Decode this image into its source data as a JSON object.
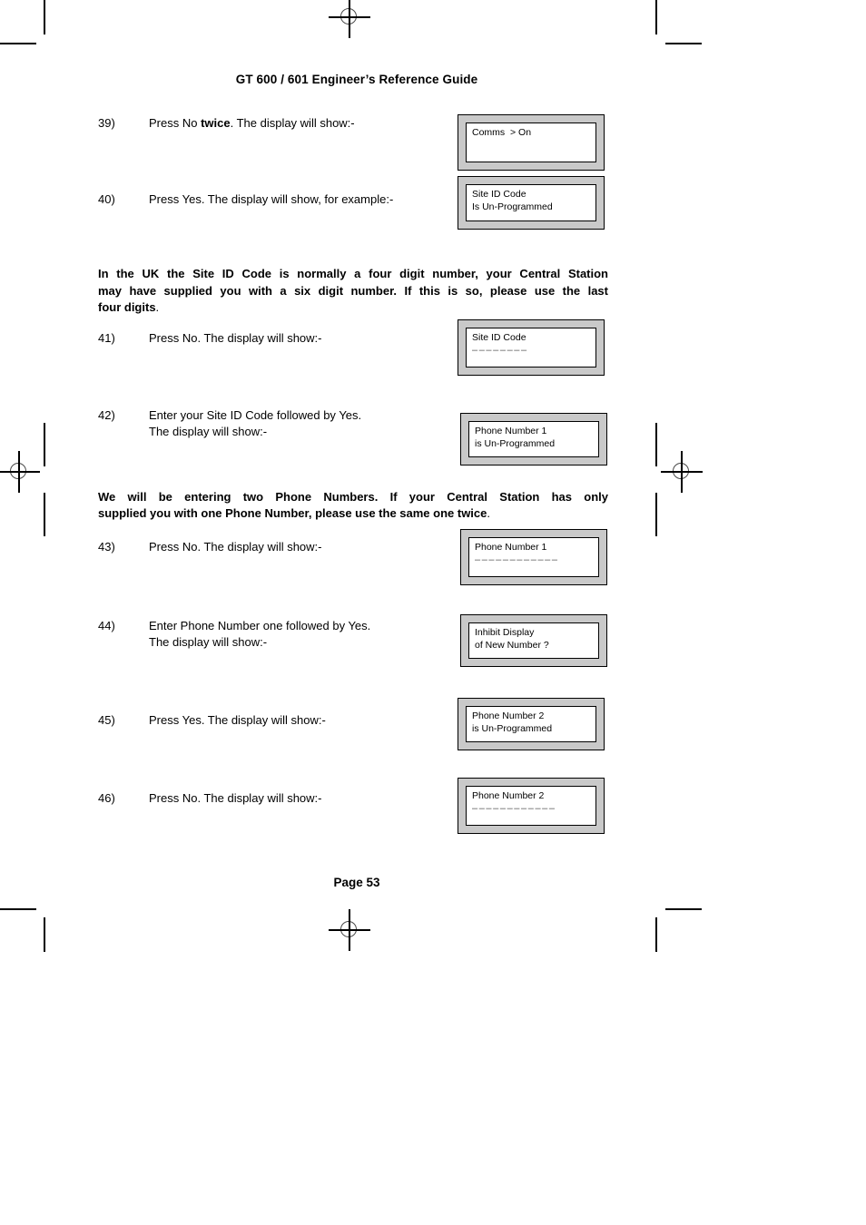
{
  "document": {
    "header": "GT 600 / 601 Engineer’s Reference Guide",
    "footer": "Page  53"
  },
  "steps": [
    {
      "number": "39)",
      "lines": [
        "Press No twice. The display will show:-"
      ],
      "bold_word": "twice",
      "display": {
        "line1": "Comms  > On",
        "line2": ""
      }
    },
    {
      "number": "40)",
      "lines": [
        "Press Yes. The display will show, for example:-"
      ],
      "display": {
        "line1": "Site ID Code",
        "line2": "Is Un-Programmed"
      }
    },
    {
      "number": "41)",
      "lines": [
        "Press No. The display will show:-"
      ],
      "display": {
        "line1": "Site ID Code",
        "line2": "––––––––"
      }
    },
    {
      "number": "42)",
      "lines": [
        "Enter your Site ID Code followed by Yes.",
        "The display will show:-"
      ],
      "display": {
        "line1": "Phone Number 1",
        "line2": "is Un-Programmed"
      }
    },
    {
      "number": "43)",
      "lines": [
        "Press No. The display will show:-"
      ],
      "display": {
        "line1": "Phone Number 1",
        "line2": "––––––––––––"
      }
    },
    {
      "number": "44)",
      "lines": [
        "Enter Phone Number one followed by Yes.",
        "The display will show:-"
      ],
      "display": {
        "line1": "Inhibit Display",
        "line2": "of New Number ?"
      }
    },
    {
      "number": "45)",
      "lines": [
        "Press Yes. The display will show:-"
      ],
      "display": {
        "line1": "Phone Number 2",
        "line2": "is Un-Programmed"
      }
    },
    {
      "number": "46)",
      "lines": [
        "Press No. The display will show:-"
      ],
      "display": {
        "line1": "Phone Number 2",
        "line2": "––––––––––––"
      }
    }
  ],
  "notes": {
    "note1": {
      "line1": "In the UK the Site ID Code is normally a four digit number, your Central Station",
      "line2": "may have supplied you with a six digit number. If this is so, please use the last",
      "line3": "four digits",
      "tail": "."
    },
    "note2": {
      "line1": "We will be entering two Phone Numbers. If your Central Station has only",
      "line2": "supplied you with one Phone Number, please use the same one twice",
      "tail": "."
    }
  },
  "colors": {
    "lcd_bezel": "#c9c9c9",
    "lcd_screen": "#ffffff",
    "ink": "#000000",
    "dash_gray": "#555555"
  }
}
